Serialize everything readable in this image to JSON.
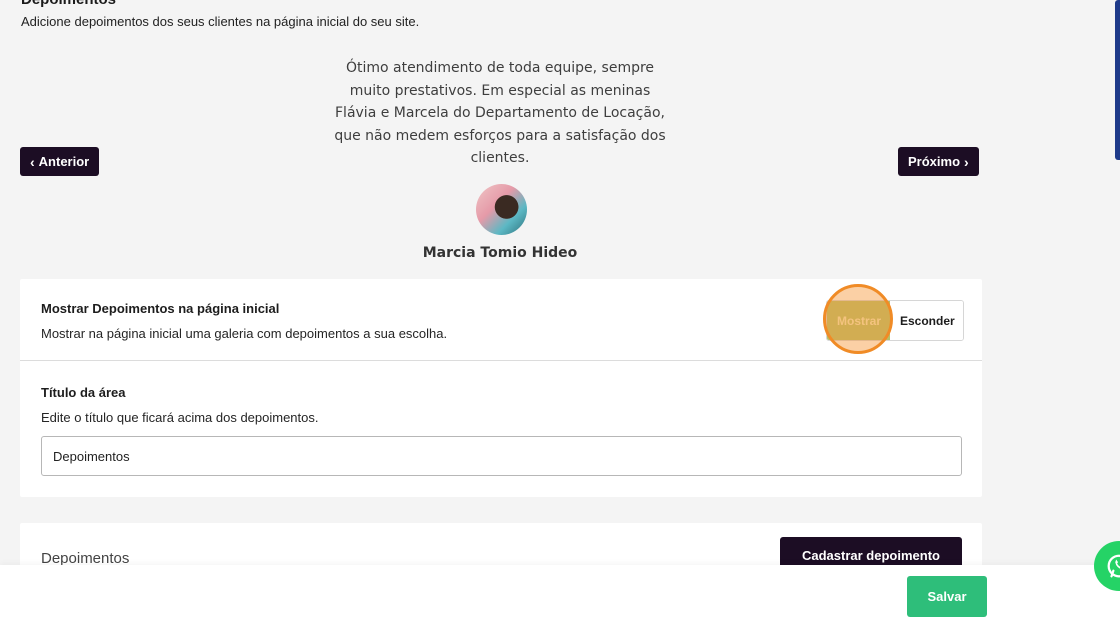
{
  "section": {
    "title": "Depoimentos",
    "subtitle": "Adicione depoimentos dos seus clientes na página inicial do seu site."
  },
  "preview": {
    "quote": "Ótimo atendimento de toda equipe, sempre muito prestativos. Em especial as meninas Flávia e Marcela do Departamento de Locação, que não medem esforços para a satisfação dos clientes.",
    "author": "Marcia Tomio Hideo",
    "prev_label": "Anterior",
    "next_label": "Próximo"
  },
  "settings": {
    "show_label": "Mostrar Depoimentos na página inicial",
    "show_desc": "Mostrar na página inicial uma galeria com depoimentos a sua escolha.",
    "toggle_on": "Mostrar",
    "toggle_off": "Esconder",
    "title_label": "Título da área",
    "title_desc": "Edite o título que ficará acima dos depoimentos.",
    "title_value": "Depoimentos"
  },
  "list": {
    "title": "Depoimentos",
    "add_label": "Cadastrar depoimento"
  },
  "footer": {
    "save_label": "Salvar"
  },
  "colors": {
    "dark": "#1c0d24",
    "accent_green": "#2ebe7a",
    "toggle_active": "#b5c069",
    "highlight": "#f08b26"
  }
}
